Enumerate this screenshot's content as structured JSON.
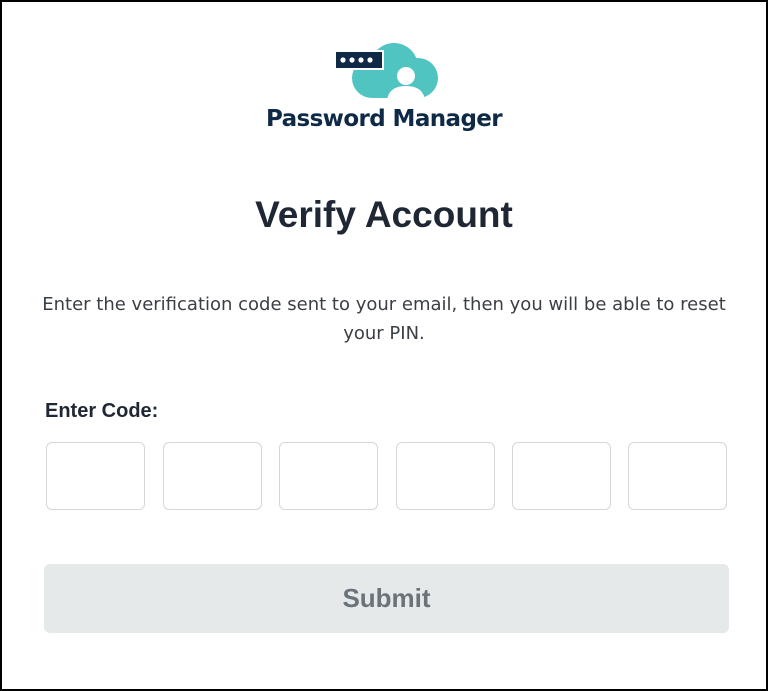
{
  "brand": {
    "name": "Password Manager",
    "icon": "cloud-password-user-icon",
    "colors": {
      "teal": "#4fc4c0",
      "navy": "#0f2a47"
    }
  },
  "page": {
    "title": "Verify Account",
    "description": "Enter the verification code sent to your email, then you will be able to reset your PIN."
  },
  "code": {
    "label": "Enter Code:",
    "digits": [
      "",
      "",
      "",
      "",
      "",
      ""
    ]
  },
  "submit": {
    "label": "Submit",
    "enabled": false
  }
}
